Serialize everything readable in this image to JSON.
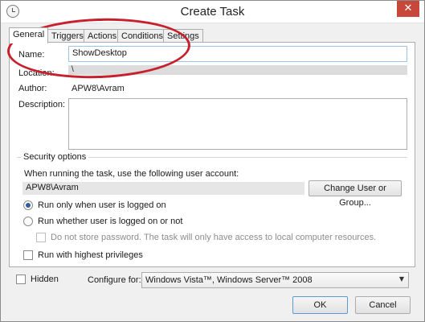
{
  "window": {
    "title": "Create Task"
  },
  "titlebar": {
    "close_glyph": "✕"
  },
  "tabs": [
    {
      "label": "General",
      "active": true
    },
    {
      "label": "Triggers",
      "active": false
    },
    {
      "label": "Actions",
      "active": false
    },
    {
      "label": "Conditions",
      "active": false
    },
    {
      "label": "Settings",
      "active": false
    }
  ],
  "general": {
    "name_label": "Name:",
    "name_value": "ShowDesktop",
    "location_label": "Location:",
    "location_value": "\\",
    "author_label": "Author:",
    "author_value": "APW8\\Avram",
    "description_label": "Description:",
    "description_value": ""
  },
  "security": {
    "group_title": "Security options",
    "account_prompt": "When running the task, use the following user account:",
    "account_value": "APW8\\Avram",
    "change_user_button": "Change User or Group...",
    "radio_logged_on": "Run only when user is logged on",
    "radio_logged_on_checked": true,
    "radio_whether_logged": "Run whether user is logged on or not",
    "radio_whether_logged_checked": false,
    "no_store_password": "Do not store password.  The task will only have access to local computer resources.",
    "no_store_password_enabled": false,
    "highest_privileges": "Run with highest privileges",
    "highest_privileges_checked": false
  },
  "footer": {
    "hidden_label": "Hidden",
    "hidden_checked": false,
    "configure_label": "Configure for:",
    "configure_value": "Windows Vista™, Windows Server™ 2008",
    "ok_button": "OK",
    "cancel_button": "Cancel"
  },
  "colors": {
    "annotation": "#c7202c",
    "close_button": "#c7483a",
    "input_focus_border": "#9ec3e6",
    "radio_dot": "#2f5d9f"
  }
}
